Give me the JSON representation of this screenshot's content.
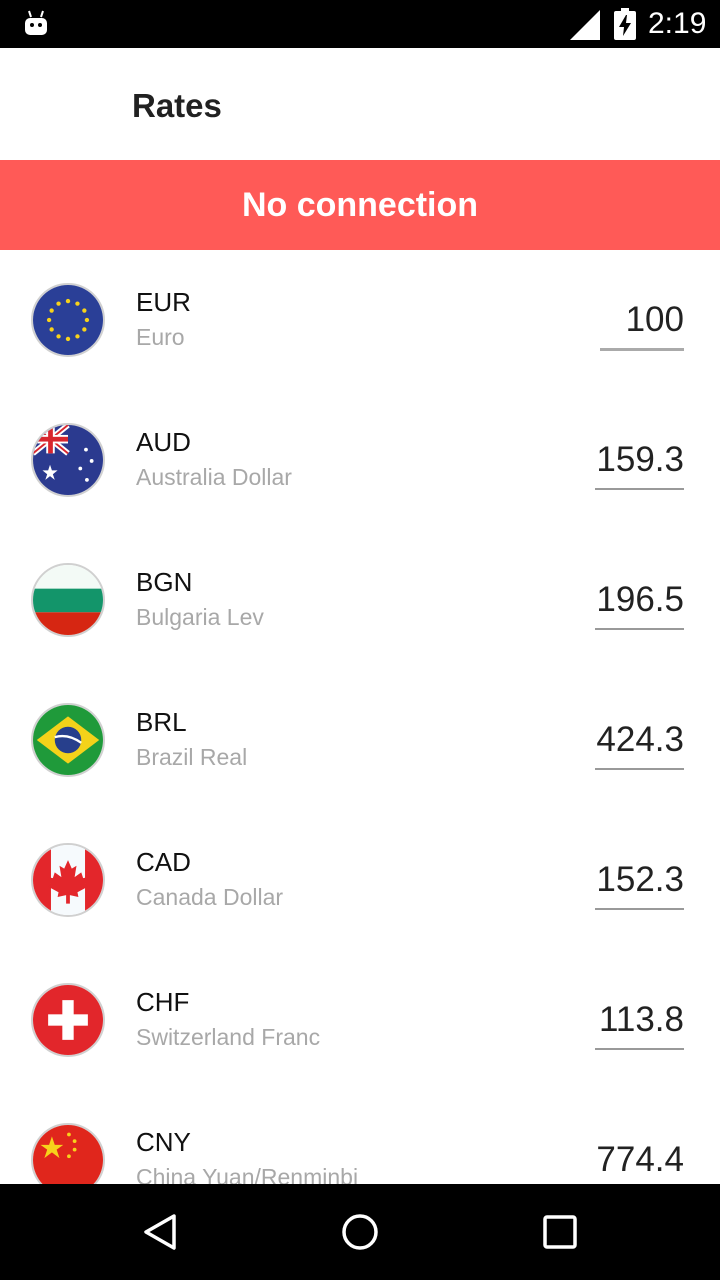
{
  "status_bar": {
    "time": "2:19",
    "icons": [
      "android-robot-icon",
      "signal-icon",
      "battery-charging-icon"
    ]
  },
  "app_bar": {
    "title": "Rates"
  },
  "banner": {
    "text": "No connection",
    "color": "#ff5a57"
  },
  "currencies": [
    {
      "code": "EUR",
      "name": "Euro",
      "amount": "100",
      "flag": "eu-flag-icon"
    },
    {
      "code": "AUD",
      "name": "Australia Dollar",
      "amount": "159.3",
      "flag": "australia-flag-icon"
    },
    {
      "code": "BGN",
      "name": "Bulgaria Lev",
      "amount": "196.5",
      "flag": "bulgaria-flag-icon"
    },
    {
      "code": "BRL",
      "name": "Brazil Real",
      "amount": "424.3",
      "flag": "brazil-flag-icon"
    },
    {
      "code": "CAD",
      "name": "Canada Dollar",
      "amount": "152.3",
      "flag": "canada-flag-icon"
    },
    {
      "code": "CHF",
      "name": "Switzerland Franc",
      "amount": "113.8",
      "flag": "switzerland-flag-icon"
    },
    {
      "code": "CNY",
      "name": "China Yuan/Renminbi",
      "amount": "774.4",
      "flag": "china-flag-icon"
    }
  ],
  "nav_bar": {
    "icons": [
      "back-icon",
      "home-icon",
      "recents-icon"
    ]
  }
}
